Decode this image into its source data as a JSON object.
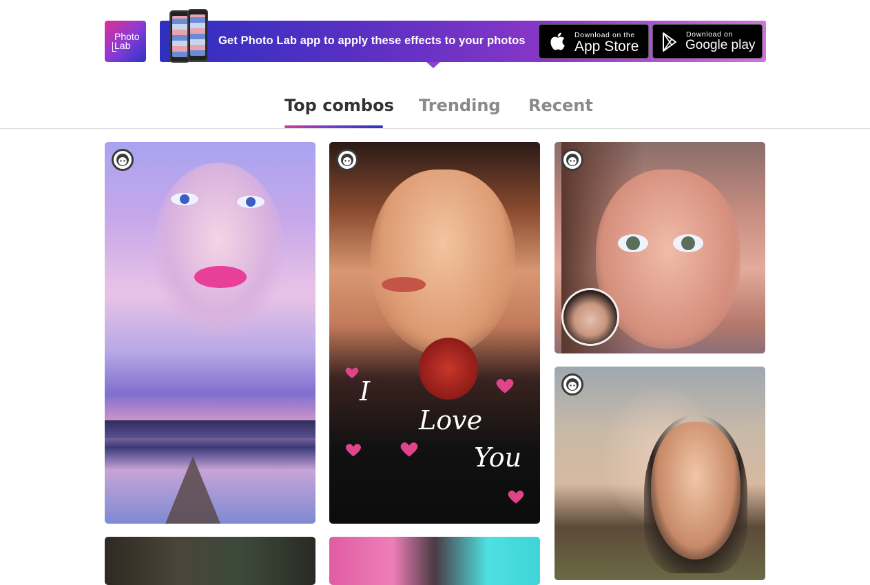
{
  "header": {
    "logo": {
      "line1": "Photo",
      "line2": "Lab"
    },
    "banner": {
      "text": "Get Photo Lab app to apply these effects to your photos",
      "app_store": {
        "small": "Download on the",
        "big": "App Store"
      },
      "google_play": {
        "small": "Download on",
        "big": "Google play"
      }
    }
  },
  "tabs": [
    {
      "label": "Top combos",
      "active": true
    },
    {
      "label": "Trending",
      "active": false
    },
    {
      "label": "Recent",
      "active": false
    }
  ],
  "cards": [
    {
      "id": "card-1",
      "badge_icon": "face-icon"
    },
    {
      "id": "card-2",
      "badge_icon": "face-icon",
      "overlay_text": [
        "I",
        "Love",
        "You"
      ]
    },
    {
      "id": "card-3",
      "badge_icon": "face-icon",
      "has_avatar_inset": true
    },
    {
      "id": "card-4",
      "badge_icon": "face-icon"
    },
    {
      "id": "card-5"
    },
    {
      "id": "card-6"
    }
  ],
  "colors": {
    "accent_start": "#d23a9b",
    "accent_end": "#2c36b8",
    "tab_active": "#333333",
    "tab_inactive": "#8a8a8a"
  }
}
